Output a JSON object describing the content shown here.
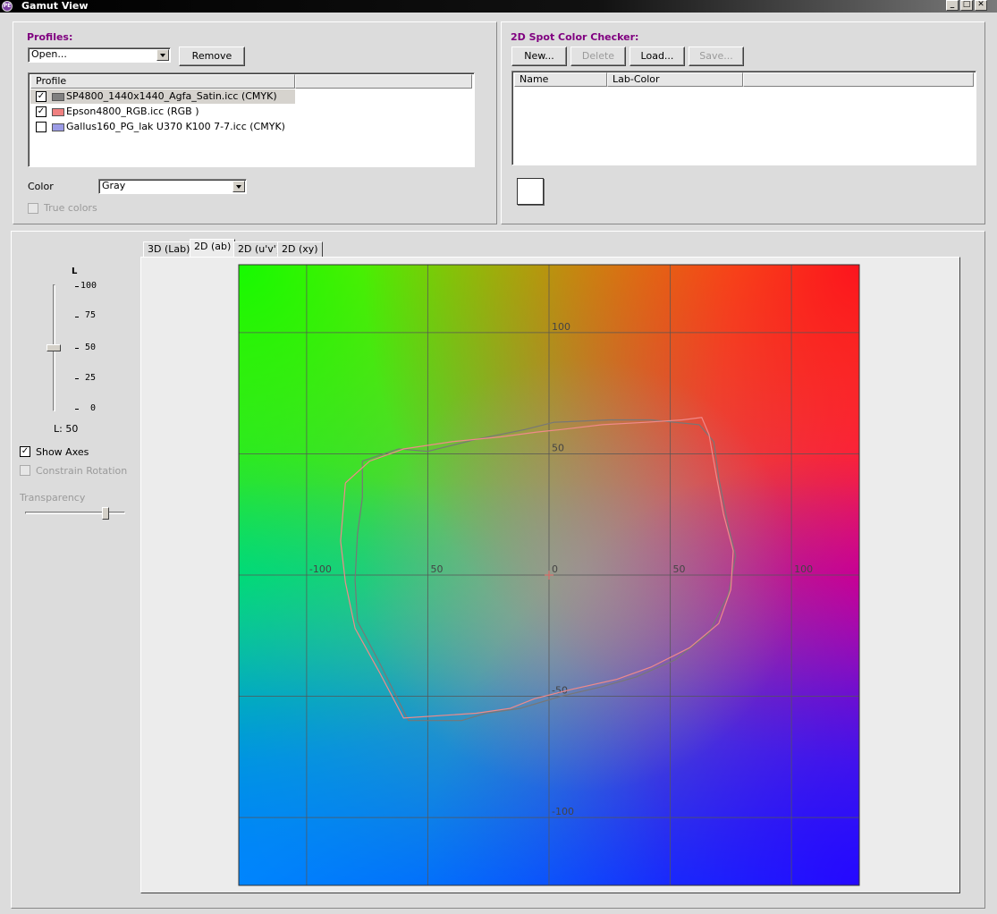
{
  "window": {
    "title": "Gamut View",
    "icon": "app-logo-icon"
  },
  "profiles": {
    "label": "Profiles:",
    "open_combo_value": "Open...",
    "remove_label": "Remove",
    "list_header": "Profile",
    "items": [
      {
        "checked": true,
        "color": "#808080",
        "name": "SP4800_1440x1440_Agfa_Satin.icc (CMYK)",
        "selected": true
      },
      {
        "checked": true,
        "color": "#f08080",
        "name": "Epson4800_RGB.icc (RGB )",
        "selected": false
      },
      {
        "checked": false,
        "color": "#9b9be6",
        "name": "Gallus160_PG_lak U370 K100 7-7.icc (CMYK)",
        "selected": false
      }
    ],
    "color_label": "Color",
    "color_value": "Gray",
    "true_colors_label": "True colors"
  },
  "spot_checker": {
    "label": "2D Spot Color Checker:",
    "buttons": {
      "new": "New...",
      "delete": "Delete",
      "load": "Load...",
      "save": "Save..."
    },
    "columns": [
      "Name",
      "Lab-Color"
    ]
  },
  "left_controls": {
    "slider_title": "L",
    "slider_ticks": [
      "100",
      "75",
      "50",
      "25",
      "0"
    ],
    "slider_value": 50,
    "l_readout": "L: 50",
    "show_axes_label": "Show Axes",
    "show_axes_checked": true,
    "constrain_rotation_label": "Constrain Rotation",
    "transparency_label": "Transparency",
    "transparency_value": 0.8
  },
  "tabs": [
    {
      "label": "3D (Lab)",
      "active": false
    },
    {
      "label": "2D (ab)",
      "active": true
    },
    {
      "label": "2D (u'v')",
      "active": false
    },
    {
      "label": "2D (xy)",
      "active": false
    }
  ],
  "chart_data": {
    "type": "line",
    "xlabel": "",
    "ylabel": "",
    "xlim": [
      -128,
      128
    ],
    "ylim": [
      -128,
      128
    ],
    "grid": true,
    "x_tick_labels": [
      {
        "value": -100,
        "text": "-100"
      },
      {
        "value": -50,
        "text": "50"
      },
      {
        "value": 0,
        "text": "0"
      },
      {
        "value": 50,
        "text": "50"
      },
      {
        "value": 100,
        "text": "100"
      }
    ],
    "y_tick_labels": [
      {
        "value": 100,
        "text": "100"
      },
      {
        "value": 50,
        "text": "50"
      },
      {
        "value": -50,
        "text": "-50"
      },
      {
        "value": -100,
        "text": "-100"
      }
    ],
    "series": [
      {
        "color": "#777777",
        "points": [
          [
            -77,
            47
          ],
          [
            -62,
            52
          ],
          [
            -50,
            51
          ],
          [
            -30,
            56
          ],
          [
            -10,
            60
          ],
          [
            2,
            63
          ],
          [
            25,
            64
          ],
          [
            42,
            64
          ],
          [
            62,
            62
          ],
          [
            68,
            55
          ],
          [
            70,
            40
          ],
          [
            74,
            20
          ],
          [
            77,
            8
          ],
          [
            74,
            -8
          ],
          [
            66,
            -24
          ],
          [
            52,
            -35
          ],
          [
            36,
            -42
          ],
          [
            22,
            -46
          ],
          [
            5,
            -50
          ],
          [
            -12,
            -55
          ],
          [
            -26,
            -57
          ],
          [
            -36,
            -60
          ],
          [
            -58,
            -60
          ],
          [
            -70,
            -36
          ],
          [
            -79,
            -19
          ],
          [
            -80,
            -2
          ],
          [
            -79,
            17
          ],
          [
            -77,
            32
          ],
          [
            -77,
            47
          ]
        ]
      },
      {
        "color": "#f08a8a",
        "points": [
          [
            -84,
            38
          ],
          [
            -74,
            47
          ],
          [
            -60,
            52
          ],
          [
            -40,
            55
          ],
          [
            -20,
            57
          ],
          [
            -5,
            59
          ],
          [
            5,
            60
          ],
          [
            22,
            62
          ],
          [
            40,
            63
          ],
          [
            55,
            64
          ],
          [
            63,
            65
          ],
          [
            66,
            58
          ],
          [
            69,
            41
          ],
          [
            72,
            25
          ],
          [
            76,
            10
          ],
          [
            75,
            -6
          ],
          [
            70,
            -20
          ],
          [
            58,
            -30
          ],
          [
            42,
            -38
          ],
          [
            28,
            -43
          ],
          [
            10,
            -47
          ],
          [
            -6,
            -51
          ],
          [
            -16,
            -55
          ],
          [
            -30,
            -57
          ],
          [
            -60,
            -59
          ],
          [
            -70,
            -40
          ],
          [
            -80,
            -22
          ],
          [
            -84,
            -3
          ],
          [
            -86,
            14
          ],
          [
            -84,
            38
          ]
        ]
      }
    ]
  }
}
